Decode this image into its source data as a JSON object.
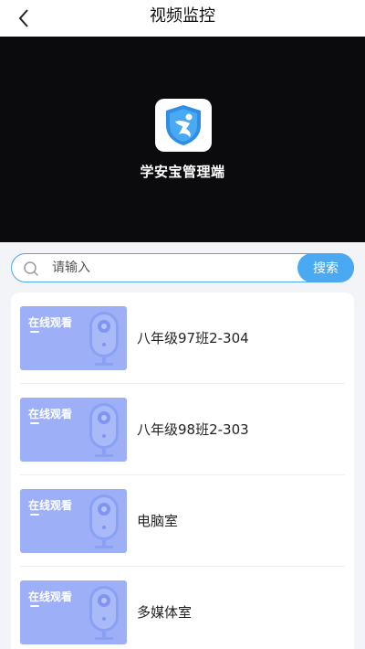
{
  "header": {
    "title": "视频监控"
  },
  "player": {
    "app_name": "学安宝管理端"
  },
  "search": {
    "placeholder": "请输入",
    "button_label": "搜索"
  },
  "rooms": [
    {
      "name": "八年级97班2-304",
      "badge": "在线观看"
    },
    {
      "name": "八年级98班2-303",
      "badge": "在线观看"
    },
    {
      "name": "电脑室",
      "badge": "在线观看"
    },
    {
      "name": "多媒体室",
      "badge": "在线观看"
    }
  ],
  "colors": {
    "accent": "#4aa9f0",
    "thumb_bg": "#9db0f7",
    "player_bg": "#0b0b0d"
  }
}
